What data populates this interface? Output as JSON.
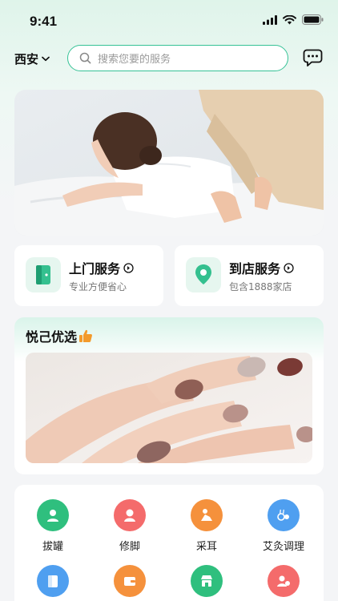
{
  "status_bar": {
    "time": "9:41"
  },
  "header": {
    "city": "西安",
    "search_placeholder": "搜索您要的服务"
  },
  "services": [
    {
      "title": "上门服务",
      "subtitle": "专业方便省心"
    },
    {
      "title": "到店服务",
      "subtitle": "包含1888家店"
    }
  ],
  "selected": {
    "title": "悦己优选"
  },
  "categories": [
    {
      "label": "拔罐",
      "color": "#2fbf7e",
      "icon": "cupping-icon"
    },
    {
      "label": "修脚",
      "color": "#f46b6b",
      "icon": "pedicure-icon"
    },
    {
      "label": "采耳",
      "color": "#f5913c",
      "icon": "ear-cleaning-icon"
    },
    {
      "label": "艾灸调理",
      "color": "#4f9ff0",
      "icon": "moxibustion-icon"
    },
    {
      "label": "",
      "color": "#4f9ff0",
      "icon": "door-icon"
    },
    {
      "label": "",
      "color": "#f5913c",
      "icon": "wallet-icon"
    },
    {
      "label": "",
      "color": "#2fbf7e",
      "icon": "store-icon"
    },
    {
      "label": "",
      "color": "#f46b6b",
      "icon": "person-icon"
    }
  ],
  "colors": {
    "accent": "#36c296",
    "background": "#f4f5f7"
  }
}
